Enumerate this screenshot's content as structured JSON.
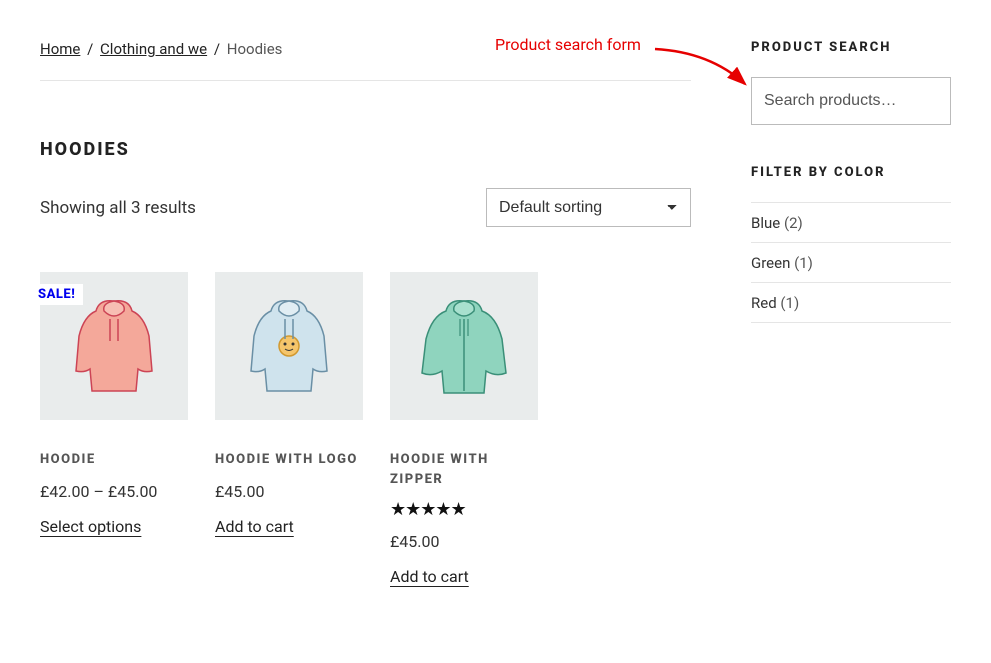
{
  "annotation": "Product search form",
  "breadcrumb": {
    "home": "Home",
    "cat": "Clothing and we",
    "current": "Hoodies"
  },
  "category_title": "HOODIES",
  "result_count": "Showing all 3 results",
  "sort_selected": "Default sorting",
  "sale_label": "SALE!",
  "products": [
    {
      "title": "HOODIE",
      "price": "£42.00 – £45.00",
      "action": "Select options"
    },
    {
      "title": "HOODIE WITH LOGO",
      "price": "£45.00",
      "action": "Add to cart"
    },
    {
      "title": "HOODIE WITH ZIPPER",
      "price": "£45.00",
      "action": "Add to cart",
      "rating": "★★★★★"
    }
  ],
  "sidebar": {
    "search_title": "PRODUCT SEARCH",
    "search_placeholder": "Search products…",
    "filter_title": "FILTER BY COLOR",
    "colors": [
      {
        "label": "Blue",
        "count": "(2)"
      },
      {
        "label": "Green",
        "count": "(1)"
      },
      {
        "label": "Red",
        "count": "(1)"
      }
    ]
  }
}
